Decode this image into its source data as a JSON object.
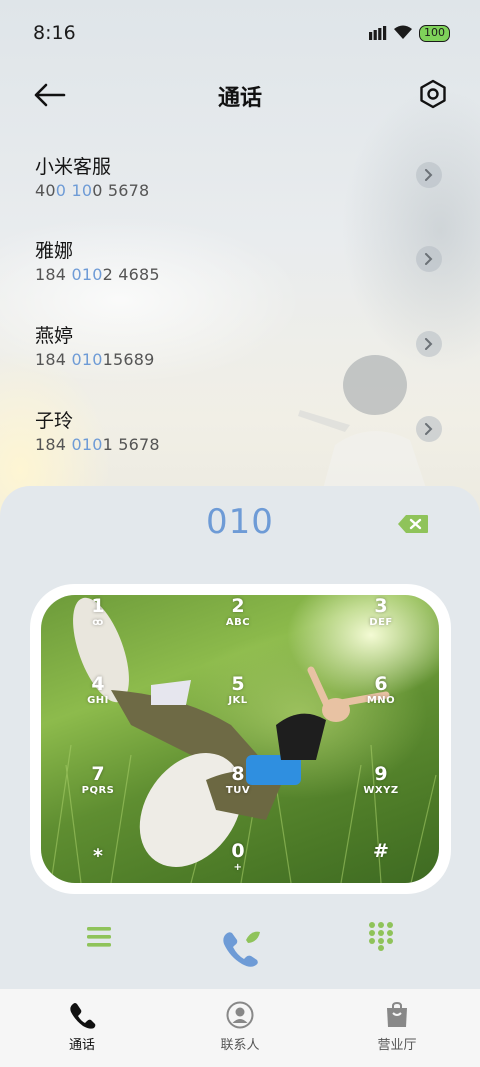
{
  "status_bar": {
    "time": "8:16",
    "battery": "100"
  },
  "header": {
    "title": "通话"
  },
  "contacts": [
    {
      "name": "小米客服",
      "number_parts": [
        {
          "t": "40"
        },
        {
          "t": "0",
          "hl": true
        },
        {
          "t": " "
        },
        {
          "t": "10",
          "hl": true
        },
        {
          "t": "0 5678"
        }
      ]
    },
    {
      "name": "雅娜",
      "number_parts": [
        {
          "t": "184 "
        },
        {
          "t": "010",
          "hl": true
        },
        {
          "t": "2 4685"
        }
      ]
    },
    {
      "name": "燕婷",
      "number_parts": [
        {
          "t": "184 "
        },
        {
          "t": "010",
          "hl": true
        },
        {
          "t": "15689"
        }
      ]
    },
    {
      "name": "子玲",
      "number_parts": [
        {
          "t": "184 "
        },
        {
          "t": "010",
          "hl": true
        },
        {
          "t": "1 5678"
        }
      ]
    }
  ],
  "dialer": {
    "input": "010"
  },
  "keypad": [
    {
      "digit": "1",
      "letters": "ꝏ"
    },
    {
      "digit": "2",
      "letters": "ABC"
    },
    {
      "digit": "3",
      "letters": "DEF"
    },
    {
      "digit": "4",
      "letters": "GHI"
    },
    {
      "digit": "5",
      "letters": "JKL"
    },
    {
      "digit": "6",
      "letters": "MNO"
    },
    {
      "digit": "7",
      "letters": "PQRS"
    },
    {
      "digit": "8",
      "letters": "TUV"
    },
    {
      "digit": "9",
      "letters": "WXYZ"
    },
    {
      "digit": "*",
      "letters": ""
    },
    {
      "digit": "0",
      "letters": "+"
    },
    {
      "digit": "#",
      "letters": ""
    }
  ],
  "tabs": [
    {
      "label": "通话",
      "icon": "phone-icon",
      "active": true
    },
    {
      "label": "联系人",
      "icon": "contacts-icon",
      "active": false
    },
    {
      "label": "营业厅",
      "icon": "shopping-bag-icon",
      "active": false
    }
  ],
  "colors": {
    "accent_blue": "#6e9bd6",
    "accent_green": "#8fc35a",
    "text_dark": "#151515"
  }
}
